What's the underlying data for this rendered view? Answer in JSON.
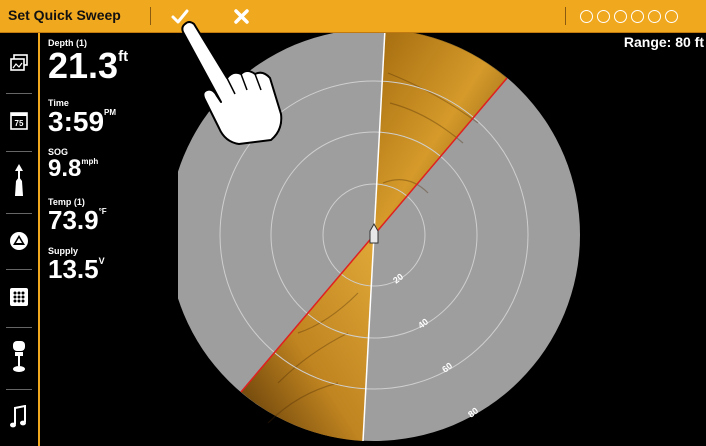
{
  "titlebar": {
    "title": "Set Quick Sweep",
    "confirm_icon": "checkmark-icon",
    "cancel_icon": "x-icon",
    "background_color": "#f0a81e"
  },
  "status_icons": [
    "person-icon",
    "gps-icon",
    "sonar-icon",
    "temperature-icon",
    "nav-icon",
    "satellite-icon"
  ],
  "sidebar": {
    "items": [
      {
        "name": "views-icon"
      },
      {
        "name": "temp-gauge-icon",
        "label": "75"
      },
      {
        "name": "navigation-icon"
      },
      {
        "name": "chart-icon"
      },
      {
        "name": "grid-menu-icon"
      },
      {
        "name": "trolling-motor-icon"
      },
      {
        "name": "music-icon"
      }
    ]
  },
  "readouts": {
    "depth": {
      "label": "Depth (1)",
      "value": "21.3",
      "unit": "ft"
    },
    "time": {
      "label": "Time",
      "value": "3:59",
      "unit": "PM"
    },
    "sog": {
      "label": "SOG",
      "value": "9.8",
      "unit": "mph"
    },
    "temp": {
      "label": "Temp (1)",
      "value": "73.9",
      "unit": "°F"
    },
    "supply": {
      "label": "Supply",
      "value": "13.5",
      "unit": "V"
    }
  },
  "range": "Range: 80 ft",
  "sonar": {
    "ring_labels": [
      "20",
      "40",
      "60",
      "80"
    ],
    "disc_color": "#9e9e9e",
    "sweep_color": "#c8901e",
    "edge_color": "#e02020"
  }
}
